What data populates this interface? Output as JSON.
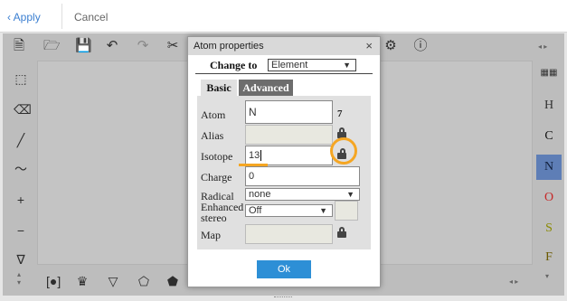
{
  "topbar": {
    "apply_label": "Apply",
    "cancel_label": "Cancel"
  },
  "toolbar": {
    "top_icons": [
      "new-file-icon",
      "open-folder-icon",
      "save-icon",
      "undo-icon",
      "redo-icon",
      "cut-icon",
      "settings-icon",
      "info-icon"
    ],
    "left_icons": [
      "selection-icon",
      "eraser-icon",
      "bond-icon",
      "chain-icon",
      "charge-plus-icon",
      "charge-minus-icon",
      "template-icon"
    ]
  },
  "periodic_table_icon": "periodic-table-icon",
  "elements": [
    {
      "symbol": "H",
      "color": "#333333",
      "active": false
    },
    {
      "symbol": "C",
      "color": "#111111",
      "active": false
    },
    {
      "symbol": "N",
      "color": "#11203d",
      "active": true
    },
    {
      "symbol": "O",
      "color": "#c62828",
      "active": false
    },
    {
      "symbol": "S",
      "color": "#8a8a00",
      "active": false
    },
    {
      "symbol": "F",
      "color": "#6b5a00",
      "active": false
    }
  ],
  "dialog": {
    "title": "Atom properties",
    "close_glyph": "×",
    "change_to_label": "Change to",
    "change_to_value": "Element",
    "tabs": {
      "basic": "Basic",
      "advanced": "Advanced"
    },
    "fields": {
      "atom": {
        "label": "Atom",
        "value": "N",
        "atomic_number": "7"
      },
      "alias": {
        "label": "Alias",
        "value": ""
      },
      "isotope": {
        "label": "Isotope",
        "value": "13"
      },
      "charge": {
        "label": "Charge",
        "value": "0"
      },
      "radical": {
        "label": "Radical",
        "value": "none"
      },
      "enhanced_stereo": {
        "label_line1": "Enhanced",
        "label_line2": "stereo",
        "value": "Off"
      },
      "map": {
        "label": "Map",
        "value": ""
      }
    },
    "ok_label": "Ok"
  },
  "colors": {
    "accent": "#2d8fd6",
    "highlight": "#f5a623",
    "link": "#3b7fd1"
  }
}
